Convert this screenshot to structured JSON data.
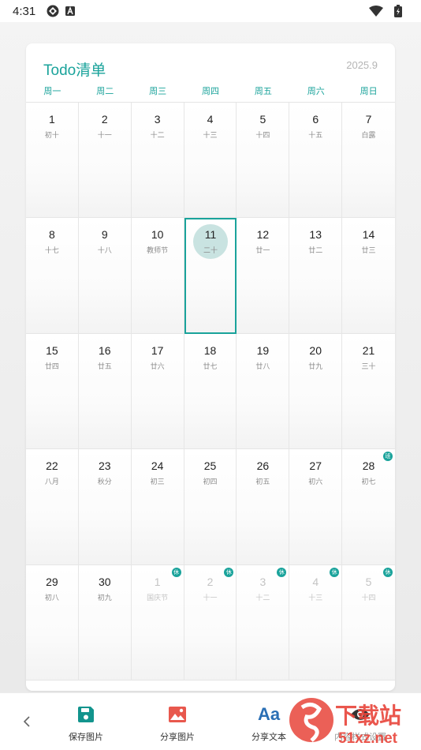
{
  "status_bar": {
    "time": "4:31"
  },
  "calendar": {
    "title": "Todo清单",
    "month": "2025.9",
    "weekdays": [
      "周一",
      "周二",
      "周三",
      "周四",
      "周五",
      "周六",
      "周日"
    ],
    "weeks": [
      [
        {
          "day": "1",
          "sub": "初十"
        },
        {
          "day": "2",
          "sub": "十一"
        },
        {
          "day": "3",
          "sub": "十二"
        },
        {
          "day": "4",
          "sub": "十三"
        },
        {
          "day": "5",
          "sub": "十四"
        },
        {
          "day": "6",
          "sub": "十五"
        },
        {
          "day": "7",
          "sub": "白露"
        }
      ],
      [
        {
          "day": "8",
          "sub": "十七"
        },
        {
          "day": "9",
          "sub": "十八"
        },
        {
          "day": "10",
          "sub": "教师节"
        },
        {
          "day": "11",
          "sub": "二十",
          "today": true
        },
        {
          "day": "12",
          "sub": "廿一"
        },
        {
          "day": "13",
          "sub": "廿二"
        },
        {
          "day": "14",
          "sub": "廿三"
        }
      ],
      [
        {
          "day": "15",
          "sub": "廿四"
        },
        {
          "day": "16",
          "sub": "廿五"
        },
        {
          "day": "17",
          "sub": "廿六"
        },
        {
          "day": "18",
          "sub": "廿七"
        },
        {
          "day": "19",
          "sub": "廿八"
        },
        {
          "day": "20",
          "sub": "廿九"
        },
        {
          "day": "21",
          "sub": "三十"
        }
      ],
      [
        {
          "day": "22",
          "sub": "八月"
        },
        {
          "day": "23",
          "sub": "秋分"
        },
        {
          "day": "24",
          "sub": "初三"
        },
        {
          "day": "25",
          "sub": "初四"
        },
        {
          "day": "26",
          "sub": "初五"
        },
        {
          "day": "27",
          "sub": "初六"
        },
        {
          "day": "28",
          "sub": "初七",
          "badge": "班"
        }
      ],
      [
        {
          "day": "29",
          "sub": "初八"
        },
        {
          "day": "30",
          "sub": "初九"
        },
        {
          "day": "1",
          "sub": "国庆节",
          "other": true,
          "badge": "休"
        },
        {
          "day": "2",
          "sub": "十一",
          "other": true,
          "badge": "休"
        },
        {
          "day": "3",
          "sub": "十二",
          "other": true,
          "badge": "休"
        },
        {
          "day": "4",
          "sub": "十三",
          "other": true,
          "badge": "休"
        },
        {
          "day": "5",
          "sub": "十四",
          "other": true,
          "badge": "休"
        }
      ]
    ]
  },
  "toolbar": {
    "save_image": "保存图片",
    "share_image": "分享图片",
    "share_text": "分享文本",
    "share_text_icon": "Aa",
    "fourth": "内容样式设置"
  },
  "watermark": {
    "main": "下载站",
    "url": "51xz.net"
  },
  "colors": {
    "accent": "#1aa39b",
    "today_fill": "#c9e3e1",
    "share_image_icon": "#e8584d",
    "share_text_icon": "#2a6fb5"
  },
  "icons": {
    "status": [
      "globe-icon",
      "a-badge-icon",
      "wifi-icon",
      "battery-charging-icon"
    ],
    "toolbar": [
      "save-icon",
      "image-icon",
      "text-aa-icon",
      "eye-icon"
    ],
    "back": "chevron-left-icon"
  }
}
